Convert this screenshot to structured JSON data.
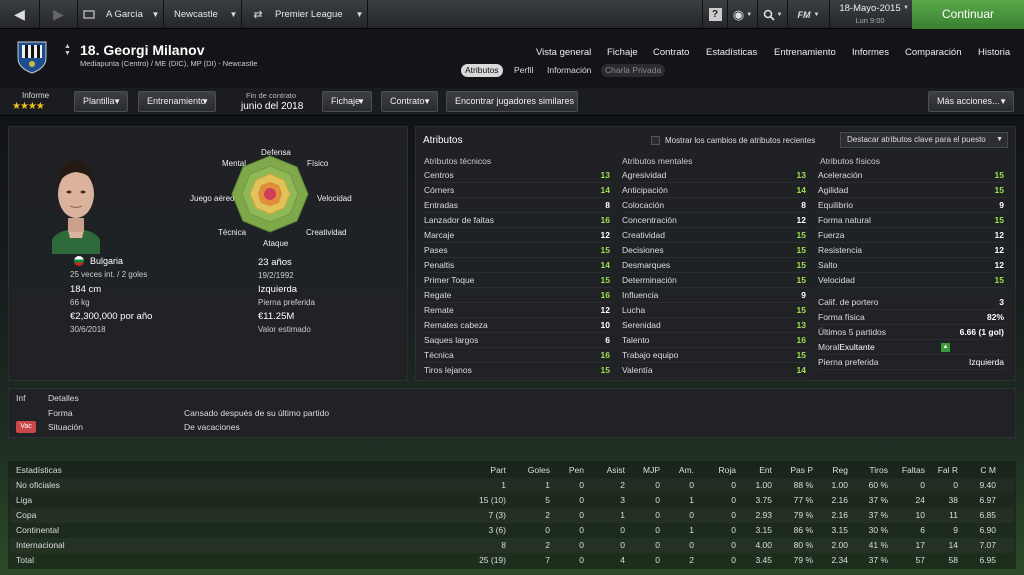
{
  "topbar": {
    "manager": "A García",
    "club": "Newcastle",
    "competition": "Premier League",
    "fm_label": "FM",
    "date": "18-Mayo-2015",
    "time": "Lun 9:00",
    "continue_label": "Continuar"
  },
  "player": {
    "title": "18. Georgi Milanov",
    "subtitle": "Mediapunta (Centro) / ME (DIC), MP (DI) - Newcastle"
  },
  "nav": {
    "main": [
      "Vista general",
      "Fichaje",
      "Contrato",
      "Estadísticas",
      "Entrenamiento",
      "Informes",
      "Comparación",
      "Historia"
    ],
    "sub": [
      "Atributos",
      "Perfil",
      "Información",
      "Charla Privada"
    ]
  },
  "toolbar": {
    "informe_label": "Informe",
    "stars": "★★★★",
    "plantilla": "Plantilla",
    "entrenamiento": "Entrenamiento",
    "contract_label": "Fin de contrato",
    "contract_date": "junio del 2018",
    "fichaje": "Fichaje",
    "contrato": "Contrato",
    "similares": "Encontrar jugadores similares",
    "mas_acciones": "Más acciones..."
  },
  "profile": {
    "nation": "Bulgaria",
    "caps": "25 veces int. / 2 goles",
    "height": "184 cm",
    "weight": "66 kg",
    "wage": "€2,300,000 por año",
    "contract_end": "30/6/2018",
    "age": "23 años",
    "dob": "19/2/1992",
    "foot": "Izquierda",
    "foot_label": "Pierna preferida",
    "value": "€11.25M",
    "value_label": "Valor estimado"
  },
  "radar": {
    "labels": {
      "defensa": "Defensa",
      "fisico": "Físico",
      "velocidad": "Velocidad",
      "creatividad": "Creatividad",
      "ataque": "Ataque",
      "tecnica": "Técnica",
      "juego_aereo": "Juego aéreo",
      "mental": "Mental"
    }
  },
  "attributes": {
    "title": "Atributos",
    "show_changes": "Mostrar los cambios de atributos recientes",
    "highlight": "Destacar atributos clave para el puesto",
    "tecnicos_title": "Atributos técnicos",
    "mentales_title": "Atributos mentales",
    "fisicos_title": "Atributos físicos",
    "tecnicos": [
      {
        "name": "Centros",
        "value": "13"
      },
      {
        "name": "Córners",
        "value": "14"
      },
      {
        "name": "Entradas",
        "value": "8"
      },
      {
        "name": "Lanzador de faltas",
        "value": "16"
      },
      {
        "name": "Marcaje",
        "value": "12"
      },
      {
        "name": "Pases",
        "value": "15"
      },
      {
        "name": "Penaltis",
        "value": "14"
      },
      {
        "name": "Primer Toque",
        "value": "15"
      },
      {
        "name": "Regate",
        "value": "16"
      },
      {
        "name": "Remate",
        "value": "12"
      },
      {
        "name": "Remates cabeza",
        "value": "10"
      },
      {
        "name": "Saques largos",
        "value": "6"
      },
      {
        "name": "Técnica",
        "value": "16"
      },
      {
        "name": "Tiros lejanos",
        "value": "15"
      }
    ],
    "mentales": [
      {
        "name": "Agresividad",
        "value": "13"
      },
      {
        "name": "Anticipación",
        "value": "14"
      },
      {
        "name": "Colocación",
        "value": "8"
      },
      {
        "name": "Concentración",
        "value": "12"
      },
      {
        "name": "Creatividad",
        "value": "15"
      },
      {
        "name": "Decisiones",
        "value": "15"
      },
      {
        "name": "Desmarques",
        "value": "15"
      },
      {
        "name": "Determinación",
        "value": "15"
      },
      {
        "name": "Influencia",
        "value": "9"
      },
      {
        "name": "Lucha",
        "value": "15"
      },
      {
        "name": "Serenidad",
        "value": "13"
      },
      {
        "name": "Talento",
        "value": "16"
      },
      {
        "name": "Trabajo equipo",
        "value": "15"
      },
      {
        "name": "Valentía",
        "value": "14"
      }
    ],
    "fisicos": [
      {
        "name": "Aceleración",
        "value": "15"
      },
      {
        "name": "Agilidad",
        "value": "15"
      },
      {
        "name": "Equilibrio",
        "value": "9"
      },
      {
        "name": "Forma natural",
        "value": "15"
      },
      {
        "name": "Fuerza",
        "value": "12"
      },
      {
        "name": "Resistencia",
        "value": "12"
      },
      {
        "name": "Salto",
        "value": "12"
      },
      {
        "name": "Velocidad",
        "value": "15"
      }
    ],
    "extra": [
      {
        "name": "Calif. de portero",
        "value": "3"
      },
      {
        "name": "Forma física",
        "value": "82%"
      },
      {
        "name": "Últimos 5 partidos",
        "value": "6.66 (1 gol)"
      },
      {
        "name": "Moral",
        "value": "Exultante"
      },
      {
        "name": "Pierna preferida",
        "value": "Izquierda"
      }
    ]
  },
  "details": {
    "inf_label": "Inf",
    "title": "Detalles",
    "forma_label": "Forma",
    "forma_value": "Cansado después de su último partido",
    "badge": "Vac",
    "situacion_label": "Situación",
    "situacion_value": "De vacaciones"
  },
  "stats": {
    "headers": [
      "Estadísticas",
      "Part",
      "Goles",
      "Pen",
      "Asist",
      "MJP",
      "Am.",
      "Roja",
      "Ent",
      "Pas P",
      "Reg",
      "Tiros",
      "Faltas",
      "Fal R",
      "C M"
    ],
    "rows": [
      [
        "No oficiales",
        "1",
        "1",
        "0",
        "2",
        "0",
        "0",
        "0",
        "1.00",
        "88 %",
        "1.00",
        "60 %",
        "0",
        "0",
        "9.40"
      ],
      [
        "Liga",
        "15 (10)",
        "5",
        "0",
        "3",
        "0",
        "1",
        "0",
        "3.75",
        "77 %",
        "2.16",
        "37 %",
        "24",
        "38",
        "6.97"
      ],
      [
        "Copa",
        "7 (3)",
        "2",
        "0",
        "1",
        "0",
        "0",
        "0",
        "2.93",
        "79 %",
        "2.16",
        "37 %",
        "10",
        "11",
        "6.85"
      ],
      [
        "Continental",
        "3 (6)",
        "0",
        "0",
        "0",
        "0",
        "1",
        "0",
        "3.15",
        "86 %",
        "3.15",
        "30 %",
        "6",
        "9",
        "6.90"
      ],
      [
        "Internacional",
        "8",
        "2",
        "0",
        "0",
        "0",
        "0",
        "0",
        "4.00",
        "80 %",
        "2.00",
        "41 %",
        "17",
        "14",
        "7.07"
      ],
      [
        "Total",
        "25 (19)",
        "7",
        "0",
        "4",
        "0",
        "2",
        "0",
        "3.45",
        "79 %",
        "2.34",
        "37 %",
        "57",
        "58",
        "6.95"
      ]
    ]
  }
}
